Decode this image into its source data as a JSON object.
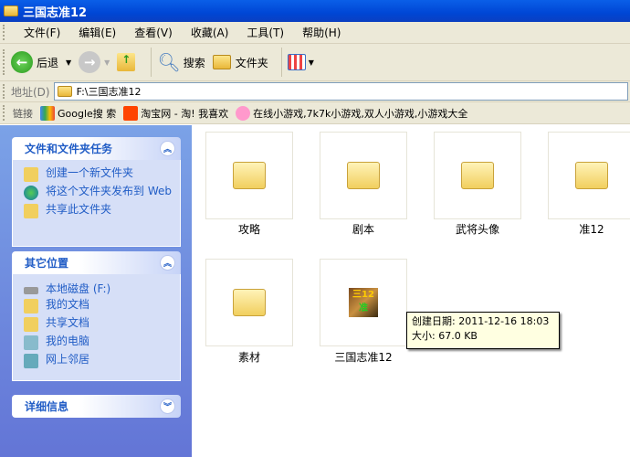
{
  "window": {
    "title": "三国志准12"
  },
  "menu": [
    "文件(F)",
    "编辑(E)",
    "查看(V)",
    "收藏(A)",
    "工具(T)",
    "帮助(H)"
  ],
  "toolbar": {
    "back": "后退",
    "search": "搜索",
    "folders": "文件夹"
  },
  "address": {
    "label": "地址(D)",
    "value": "F:\\三国志准12"
  },
  "links": {
    "label": "链接",
    "items": [
      "Google搜 索",
      "淘宝网 - 淘! 我喜欢",
      "在线小游戏,7k7k小游戏,双人小游戏,小游戏大全"
    ]
  },
  "tasks": {
    "title": "文件和文件夹任务",
    "items": [
      "创建一个新文件夹",
      "将这个文件夹发布到 Web",
      "共享此文件夹"
    ]
  },
  "places": {
    "title": "其它位置",
    "items": [
      "本地磁盘 (F:)",
      "我的文档",
      "共享文档",
      "我的电脑",
      "网上邻居"
    ]
  },
  "details": {
    "title": "详细信息"
  },
  "files": [
    "攻略",
    "剧本",
    "武将头像",
    "准12",
    "素材",
    "三国志准12"
  ],
  "tooltip": {
    "created": "创建日期: 2011-12-16 18:03",
    "size": "大小: 67.0 KB"
  }
}
